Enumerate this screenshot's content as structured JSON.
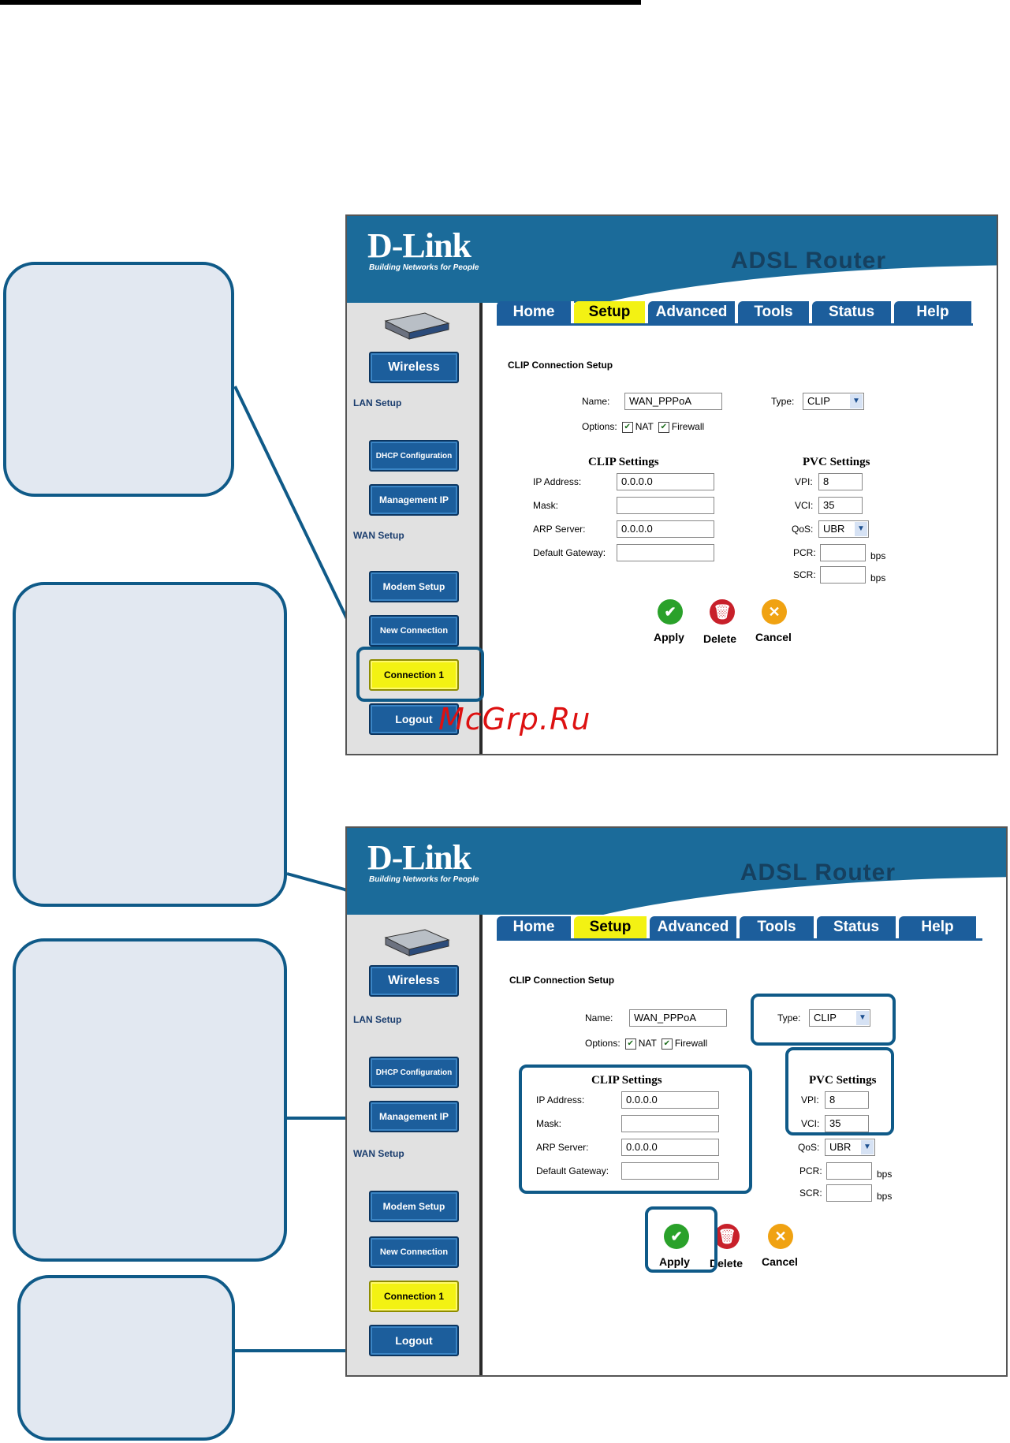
{
  "brand": {
    "logo": "D-Link",
    "tagline": "Building Networks for People",
    "product": "ADSL Router"
  },
  "tabs": [
    "Home",
    "Setup",
    "Advanced",
    "Tools",
    "Status",
    "Help"
  ],
  "sidebar": {
    "wireless": "Wireless",
    "lan_setup": "LAN Setup",
    "dhcp": "DHCP Configuration",
    "management": "Management IP",
    "wan_setup": "WAN Setup",
    "modem": "Modem Setup",
    "new_connection": "New Connection",
    "connection1": "Connection 1",
    "logout": "Logout"
  },
  "form": {
    "section_title": "CLIP Connection Setup",
    "name_label": "Name:",
    "name_value": "WAN_PPPoA",
    "type_label": "Type:",
    "type_value": "CLIP",
    "options_label": "Options:",
    "nat": "NAT",
    "firewall": "Firewall",
    "clip_title": "CLIP Settings",
    "ip_label": "IP Address:",
    "ip_value": "0.0.0.0",
    "mask_label": "Mask:",
    "arp_label": "ARP Server:",
    "arp_value": "0.0.0.0",
    "gw_label": "Default Gateway:",
    "pvc_title": "PVC Settings",
    "vpi_label": "VPI:",
    "vpi_value": "8",
    "vci_label": "VCI:",
    "vci_value": "35",
    "qos_label": "QoS:",
    "qos_value": "UBR",
    "pcr_label": "PCR:",
    "scr_label": "SCR:",
    "bps": "bps",
    "apply": "Apply",
    "delete": "Delete",
    "cancel": "Cancel"
  },
  "watermark": "McGrp.Ru",
  "colors": {
    "callout_border": "#0f5a88",
    "callout_fill": "#e2e8f1",
    "header_blue": "#1b6b9a",
    "active_yellow": "#f3f213"
  }
}
